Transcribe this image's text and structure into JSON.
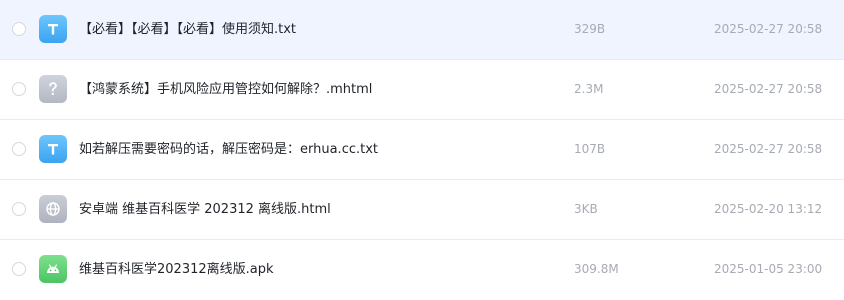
{
  "files": [
    {
      "icon": "txt-file-icon",
      "name": "【必看】【必看】【必看】使用须知.txt",
      "size": "329B",
      "date": "2025-02-27 20:58",
      "selected": true
    },
    {
      "icon": "unknown-file-icon",
      "name": "【鸿蒙系统】手机风险应用管控如何解除？.mhtml",
      "size": "2.3M",
      "date": "2025-02-27 20:58",
      "selected": false
    },
    {
      "icon": "txt-file-icon",
      "name": "如若解压需要密码的话，解压密码是：erhua.cc.txt",
      "size": "107B",
      "date": "2025-02-27 20:58",
      "selected": false
    },
    {
      "icon": "html-globe-icon",
      "name": "安卓端 维基百科医学 202312 离线版.html",
      "size": "3KB",
      "date": "2025-02-20 13:12",
      "selected": false
    },
    {
      "icon": "android-apk-icon",
      "name": "维基百科医学202312离线版.apk",
      "size": "309.8M",
      "date": "2025-01-05 23:00",
      "selected": false
    }
  ],
  "colors": {
    "selected_row_bg": "#f0f4fe",
    "txt_icon": "#3aa3f1",
    "apk_icon": "#4cc563",
    "unknown_icon": "#b3b8c4"
  }
}
